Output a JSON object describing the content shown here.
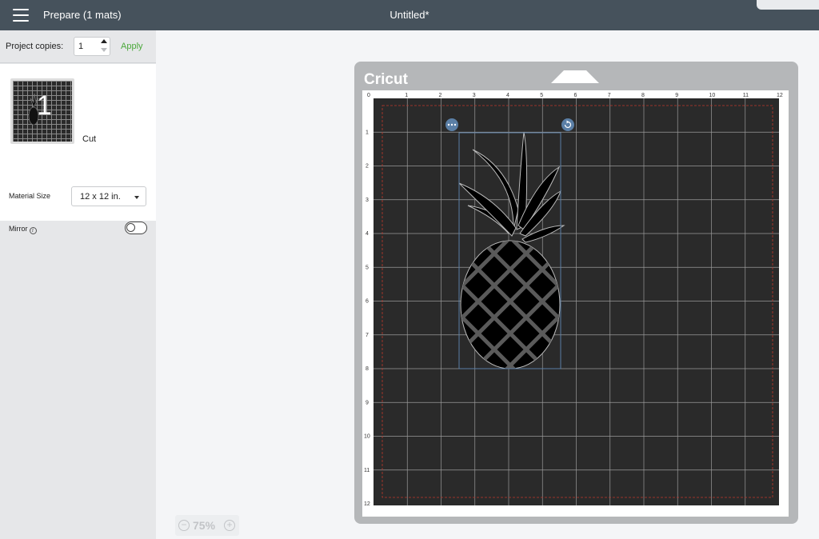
{
  "header": {
    "menu_icon": "hamburger-menu-icon",
    "prepare_title": "Prepare (1 mats)",
    "document_title": "Untitled*"
  },
  "left_panel": {
    "copies_label": "Project copies:",
    "copies_value": "1",
    "apply_label": "Apply",
    "mat": {
      "number": "1",
      "type_label": "Cut"
    },
    "material_size_label": "Material Size",
    "material_size_value": "12 x 12 in.",
    "mirror_label": "Mirror",
    "mirror_on": false
  },
  "zoom": {
    "value": "75%",
    "out_icon": "zoom-out-icon",
    "in_icon": "zoom-in-icon"
  },
  "canvas": {
    "brand": "Cricut",
    "ruler_labels": [
      "0",
      "1",
      "2",
      "3",
      "4",
      "5",
      "6",
      "7",
      "8",
      "9",
      "10",
      "11",
      "12"
    ],
    "selection_menu_icon": "more-options-icon",
    "selection_rotate_icon": "rotate-icon",
    "colors": {
      "mat_frame": "#b5b7b9",
      "mat_surface": "#2a2a2a",
      "grid": "#9a9a9a",
      "cut_boundary": "#c0392b",
      "selection": "#5b7fa6",
      "accent_green": "#4aa83a"
    }
  }
}
